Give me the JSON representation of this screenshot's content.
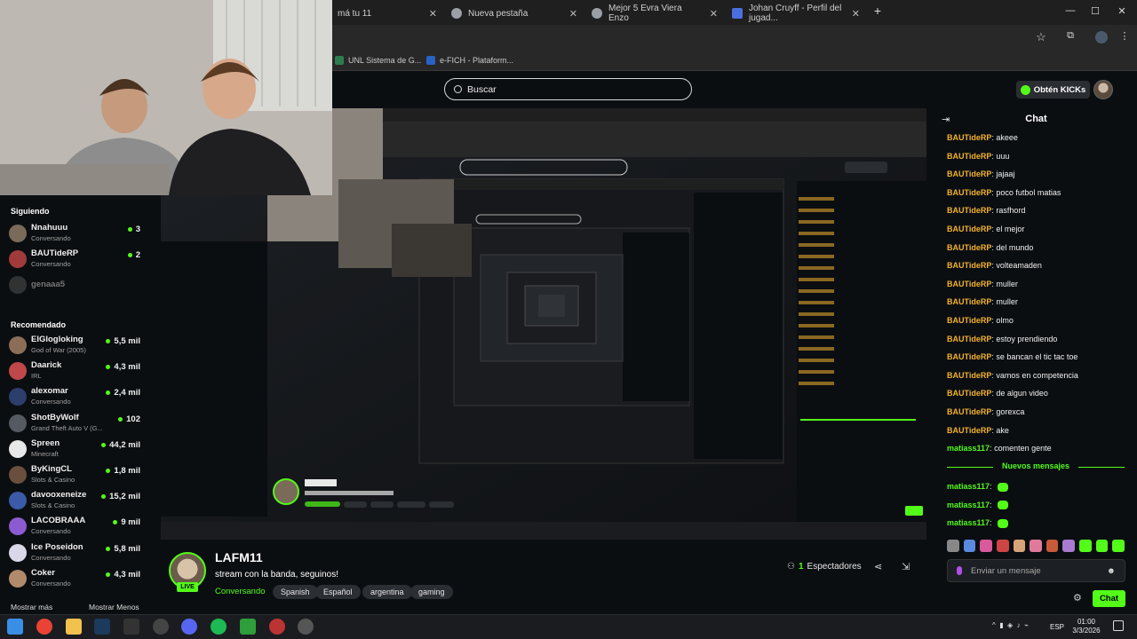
{
  "browser": {
    "tabs": [
      {
        "label": "má tu 11",
        "color": "#ffffff"
      },
      {
        "label": "Nueva pestaña",
        "color": "#9aa0a6"
      },
      {
        "label": "Mejor 5 Evra Viera Enzo",
        "color": "#9aa0a6"
      },
      {
        "label": "Johan Cruyff - Perfil del jugad...",
        "color": "#4a6ee0"
      }
    ],
    "new_tab_icon": "plus-icon",
    "bookmarks": [
      "UNL Sistema de G...",
      "e-FICH - Plataform..."
    ]
  },
  "header": {
    "search_placeholder": "Buscar",
    "kicks_label": "Obtén KICKs"
  },
  "sidebar": {
    "following_title": "Siguiendo",
    "following": [
      {
        "name": "Nnahuuu",
        "sub": "Conversando",
        "count": "3",
        "color": "#7a6a5a"
      },
      {
        "name": "BAUTideRP",
        "sub": "Conversando",
        "count": "2",
        "color": "#a13a3a"
      },
      {
        "name": "genaaa5",
        "sub": "",
        "count": "",
        "color": "#555555"
      }
    ],
    "recommended_title": "Recomendado",
    "recommended": [
      {
        "name": "ElGlogloking",
        "sub": "God of War (2005)",
        "count": "5,5 mil",
        "color": "#8c6e58"
      },
      {
        "name": "Daarick",
        "sub": "IRL",
        "count": "4,3 mil",
        "color": "#c0484a"
      },
      {
        "name": "alexomar",
        "sub": "Conversando",
        "count": "2,4 mil",
        "color": "#2c3e6b"
      },
      {
        "name": "ShotByWolf",
        "sub": "Grand Theft Auto V (G...",
        "count": "102",
        "color": "#555a62"
      },
      {
        "name": "Spreen",
        "sub": "Minecraft",
        "count": "44,2 mil",
        "color": "#e8e8e8"
      },
      {
        "name": "ByKingCL",
        "sub": "Slots & Casino",
        "count": "1,8 mil",
        "color": "#6a4f3e"
      },
      {
        "name": "davooxeneize",
        "sub": "Slots & Casino",
        "count": "15,2 mil",
        "color": "#3b5ba8"
      },
      {
        "name": "LACOBRAAA",
        "sub": "Conversando",
        "count": "9 mil",
        "color": "#8d5bd1"
      },
      {
        "name": "Ice Poseidon",
        "sub": "Conversando",
        "count": "5,8 mil",
        "color": "#d8d8e8"
      },
      {
        "name": "Coker",
        "sub": "Conversando",
        "count": "4,3 mil",
        "color": "#b08a6a"
      }
    ],
    "show_more": "Mostrar más",
    "show_less": "Mostrar Menos"
  },
  "stream": {
    "streamer": "LAFM11",
    "live_badge": "LIVE",
    "title": "stream con la banda, seguinos!",
    "category": "Conversando",
    "tags": [
      "Spanish",
      "Español",
      "argentina",
      "gaming"
    ],
    "viewers_count": "1",
    "viewers_label": "Espectadores"
  },
  "chat": {
    "title": "Chat",
    "messages": [
      {
        "user": "BAUTideRP",
        "text": "akeee"
      },
      {
        "user": "BAUTideRP",
        "text": "uuu"
      },
      {
        "user": "BAUTideRP",
        "text": "jajaaj"
      },
      {
        "user": "BAUTideRP",
        "text": "poco futbol matias"
      },
      {
        "user": "BAUTideRP",
        "text": "rasfhord"
      },
      {
        "user": "BAUTideRP",
        "text": "el mejor"
      },
      {
        "user": "BAUTideRP",
        "text": "del mundo"
      },
      {
        "user": "BAUTideRP",
        "text": "volteamaden"
      },
      {
        "user": "BAUTideRP",
        "text": "muller"
      },
      {
        "user": "BAUTideRP",
        "text": "muller"
      },
      {
        "user": "BAUTideRP",
        "text": "olmo"
      },
      {
        "user": "BAUTideRP",
        "text": "estoy prendiendo"
      },
      {
        "user": "BAUTideRP",
        "text": "se bancan el tic tac toe"
      },
      {
        "user": "BAUTideRP",
        "text": "vamos en competencia"
      },
      {
        "user": "BAUTideRP",
        "text": "de algun video"
      },
      {
        "user": "BAUTideRP",
        "text": "gorexca"
      },
      {
        "user": "BAUTideRP",
        "text": "ake"
      },
      {
        "user": "matiass117",
        "text": "comenten gente"
      }
    ],
    "new_messages_label": "Nuevos mensajes",
    "new_messages": [
      {
        "user": "matiass117",
        "text": ""
      },
      {
        "user": "matiass117",
        "text": ""
      },
      {
        "user": "matiass117",
        "text": ""
      }
    ],
    "input_placeholder": "Enviar un mensaje",
    "send_label": "Chat"
  },
  "taskbar": {
    "lang": "ESP",
    "time": "01:00",
    "date": "3/3/2026"
  },
  "colors": {
    "accent": "#53fc18",
    "username": "#f2b230",
    "background": "#0b0e11"
  }
}
